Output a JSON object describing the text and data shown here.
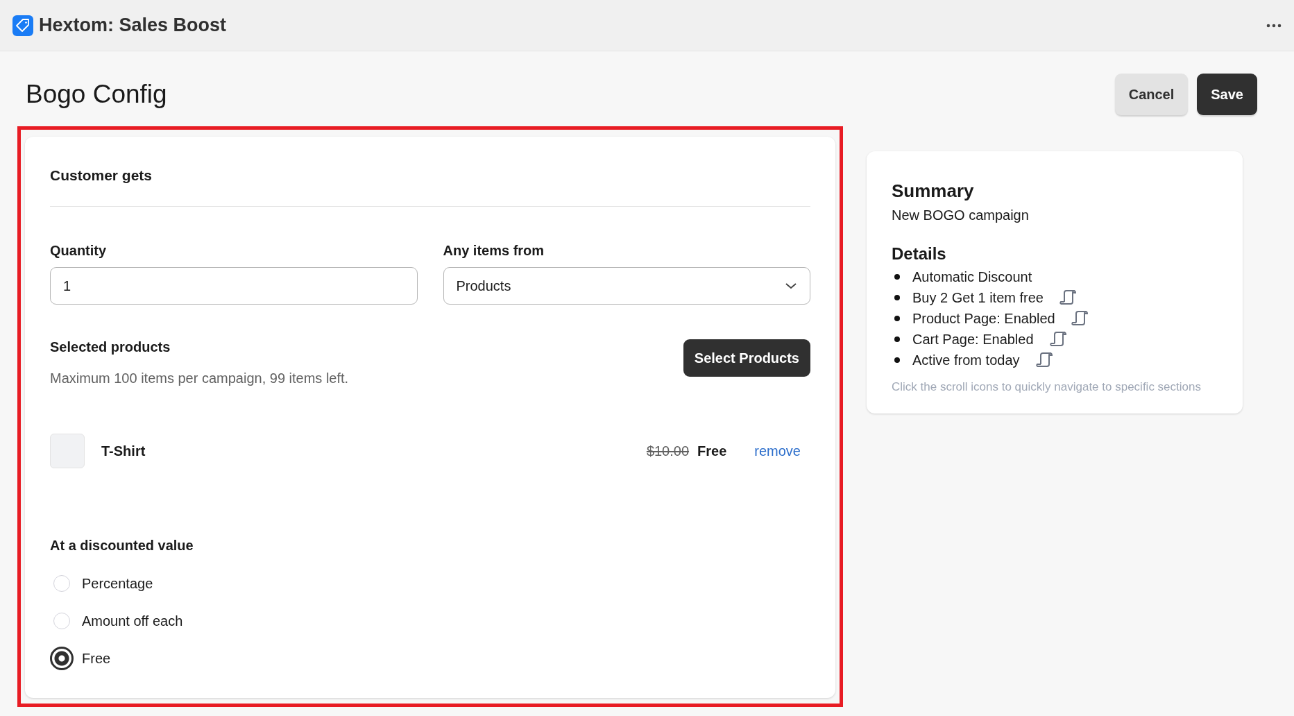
{
  "app_bar": {
    "title": "Hextom: Sales Boost"
  },
  "page": {
    "title": "Bogo Config",
    "actions": [
      {
        "label": "Cancel",
        "kind": "secondary"
      },
      {
        "label": "Save",
        "kind": "primary"
      }
    ]
  },
  "customer_gets": {
    "highlighted": true,
    "title": "Customer gets",
    "quantity": {
      "label": "Quantity",
      "value": "1"
    },
    "items_from": {
      "label": "Any items from",
      "value": "Products"
    },
    "selected_products": {
      "title": "Selected products",
      "hint": "Maximum 100 items per campaign, 99 items left.",
      "button": "Select Products",
      "items": [
        {
          "name": "T-Shirt",
          "original_price": "$10.00",
          "price": "Free",
          "action": "remove"
        }
      ]
    },
    "discount": {
      "title": "At a discounted value",
      "options": [
        {
          "label": "Percentage",
          "selected": false
        },
        {
          "label": "Amount off each",
          "selected": false
        },
        {
          "label": "Free",
          "selected": true
        }
      ]
    }
  },
  "summary": {
    "title": "Summary",
    "subtitle": "New BOGO campaign",
    "details_title": "Details",
    "details": [
      {
        "text": "Automatic Discount",
        "scroll_link": false
      },
      {
        "text": "Buy 2 Get 1 item free",
        "scroll_link": true
      },
      {
        "text": "Product Page: Enabled",
        "scroll_link": true
      },
      {
        "text": "Cart Page: Enabled",
        "scroll_link": true
      },
      {
        "text": "Active from today",
        "scroll_link": true
      }
    ],
    "note": "Click the scroll icons to quickly navigate to specific sections"
  }
}
